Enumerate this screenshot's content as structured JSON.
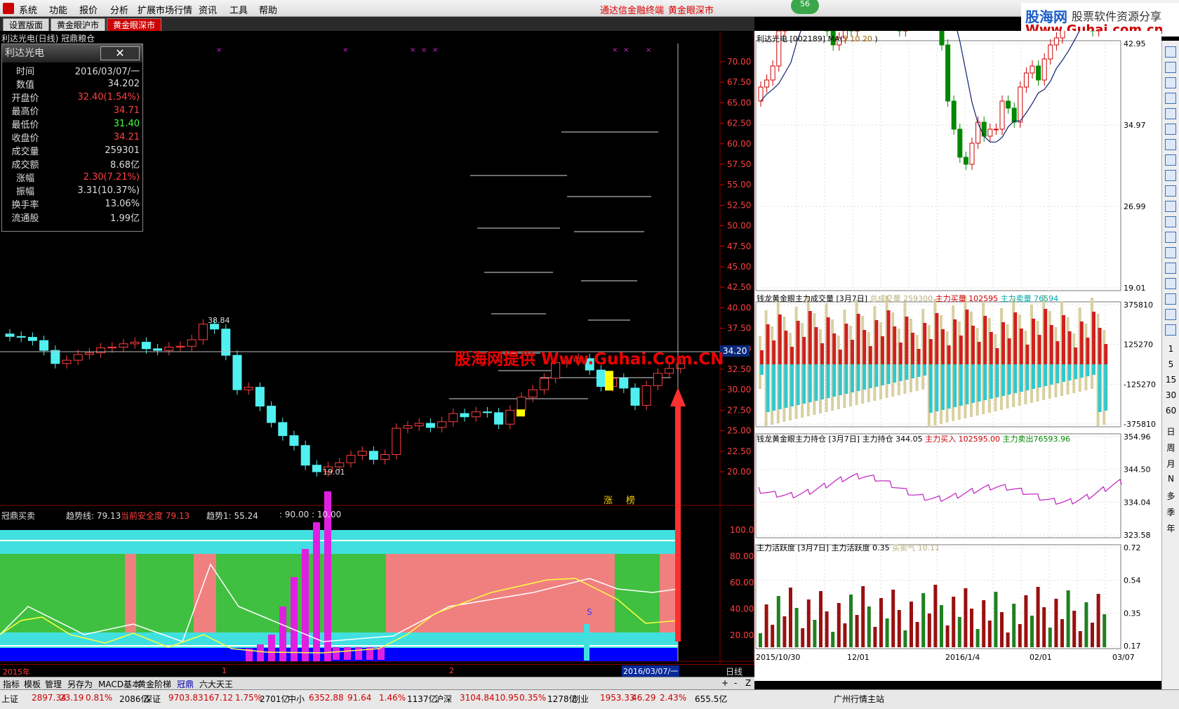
{
  "menu": {
    "items": [
      "系统",
      "功能",
      "报价",
      "分析",
      "扩展市场行情",
      "资讯",
      "工具",
      "帮助"
    ],
    "red1": "通达信金融终端",
    "red2": "黄金眼深市",
    "badge": "56"
  },
  "tabs": [
    "设置版面",
    "黄金眼沪市",
    "黄金眼深市"
  ],
  "brand": {
    "cn": "股海网",
    "sub": "股票软件资源分享",
    "url": "Www.Guhai.com.cn"
  },
  "chart_header": "利达光电(日线) 冠鼎粮仓",
  "info": {
    "title": "利达光电",
    "close": "✕",
    "rows": [
      [
        "时间",
        "2016/03/07/一"
      ],
      [
        "数值",
        "34.202"
      ],
      [
        "开盘价",
        "32.40(1.54%)"
      ],
      [
        "最高价",
        "34.71"
      ],
      [
        "最低价",
        "31.40"
      ],
      [
        "收盘价",
        "34.21"
      ],
      [
        "成交量",
        "259301"
      ],
      [
        "成交额",
        "8.68亿"
      ],
      [
        "涨幅",
        "2.30(7.21%)"
      ],
      [
        "振幅",
        "3.31(10.37%)"
      ],
      [
        "换手率",
        "13.06%"
      ],
      [
        "流通股",
        "1.99亿"
      ]
    ],
    "colors": [
      "#ddd",
      "#ddd",
      "#ff4040",
      "#ff4040",
      "#40ff40",
      "#ff4040",
      "#ddd",
      "#ddd",
      "#ff4040",
      "#ddd",
      "#ddd",
      "#ddd"
    ]
  },
  "main_axis": {
    "labels": [
      "70.00",
      "67.50",
      "65.00",
      "62.50",
      "60.00",
      "57.50",
      "55.00",
      "52.50",
      "50.00",
      "47.50",
      "45.00",
      "42.50",
      "40.00",
      "37.50",
      "35.00",
      "32.50",
      "30.00",
      "27.50",
      "25.00",
      "22.50",
      "20.00"
    ],
    "cur": "34.20",
    "hi": "38.84",
    "lo": "19.01"
  },
  "watermark": "股海网提供 Www.Guhai.Com.CN",
  "tags": {
    "a": "涨",
    "b": "榜"
  },
  "indicator": {
    "name": "冠鼎买卖",
    "l1": "趋势线: 79.13",
    "l2": "当前安全度 79.13",
    "l3": "趋势1: 55.24",
    "l4": ": 90.00 : 10.00",
    "axis": [
      "100.0",
      "80.00",
      "60.00",
      "40.00",
      "20.00"
    ],
    "s": "S"
  },
  "date_axis": {
    "a": "2015年",
    "b": "1",
    "c": "2",
    "d": "2016/03/07/一",
    "period": "日线"
  },
  "bottom_tabs": [
    "指标",
    "模板",
    "管理",
    "另存为",
    "MACD基本",
    "黄金阶梯",
    "冠鼎",
    "六大天王"
  ],
  "scroll_btns": [
    "+",
    "-",
    "Z"
  ],
  "status": [
    "上证",
    "2897.34",
    "23.19",
    "0.81%",
    "2086亿",
    "深证",
    "9703.83",
    "167.12",
    "1.75%",
    "2701亿",
    "中小",
    "6352.88",
    "91.64",
    "1.46%",
    "1137亿",
    "沪深",
    "3104.84",
    "10.95",
    "0.35%",
    "1278亿",
    "创业",
    "1953.33",
    "46.29",
    "2.43%",
    "655.5亿",
    "广州行情主站"
  ],
  "right": {
    "p1": {
      "t1": "利达光电",
      "t2": "[002189] MA(",
      "t3": "5 10 20",
      "t4": ")",
      "axis": [
        "42.95",
        "34.97",
        "26.99",
        "19.01"
      ]
    },
    "p2": {
      "t1": "钱龙黄金眼主力成交量 [3月7日]",
      "t2": "总成交量",
      "v2": "259300",
      "t3": "主力买量",
      "v3": "102595",
      "t4": "主力卖量",
      "v4": "76594",
      "axis": [
        "375810",
        "125270",
        "-125270",
        "-375810"
      ]
    },
    "p3": {
      "t1": "钱龙黄金眼主力持仓 [3月7日]",
      "t2": "主力持仓 344.05",
      "t3": "主力买入 102595.00",
      "t4": "主力卖出76593.96",
      "axis": [
        "354.96",
        "344.50",
        "334.04",
        "323.58"
      ]
    },
    "p4": {
      "t1": "主力活跃度 [3月7日]",
      "t2": "主力活跃度 0.35",
      "t3": "买卖气 10.11",
      "axis": [
        "0.72",
        "0.54",
        "0.35",
        "0.17"
      ]
    },
    "dates": [
      "2015/10/30",
      "12/01",
      "2016/1/4",
      "02/01",
      "03/07"
    ]
  },
  "sidebar": {
    "nums": [
      "1",
      "5",
      "15",
      "30",
      "60"
    ],
    "periods": [
      "日",
      "周",
      "月",
      "N",
      "多",
      "季",
      "年"
    ]
  }
}
